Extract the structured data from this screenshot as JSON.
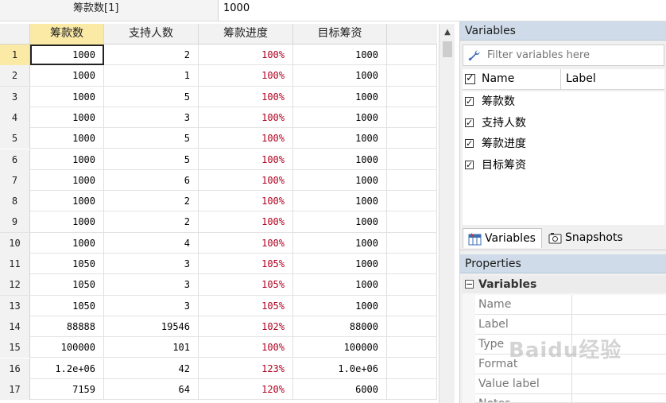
{
  "editbar": {
    "cell_ref": "筹款数[1]",
    "cell_value": "1000"
  },
  "grid": {
    "columns": [
      "筹款数",
      "支持人数",
      "筹款进度",
      "目标筹资"
    ],
    "rows": [
      {
        "n": "1",
        "a": "1000",
        "b": "2",
        "c": "100%",
        "d": "1000"
      },
      {
        "n": "2",
        "a": "1000",
        "b": "1",
        "c": "100%",
        "d": "1000"
      },
      {
        "n": "3",
        "a": "1000",
        "b": "5",
        "c": "100%",
        "d": "1000"
      },
      {
        "n": "4",
        "a": "1000",
        "b": "3",
        "c": "100%",
        "d": "1000"
      },
      {
        "n": "5",
        "a": "1000",
        "b": "5",
        "c": "100%",
        "d": "1000"
      },
      {
        "n": "6",
        "a": "1000",
        "b": "5",
        "c": "100%",
        "d": "1000"
      },
      {
        "n": "7",
        "a": "1000",
        "b": "6",
        "c": "100%",
        "d": "1000"
      },
      {
        "n": "8",
        "a": "1000",
        "b": "2",
        "c": "100%",
        "d": "1000"
      },
      {
        "n": "9",
        "a": "1000",
        "b": "2",
        "c": "100%",
        "d": "1000"
      },
      {
        "n": "10",
        "a": "1000",
        "b": "4",
        "c": "100%",
        "d": "1000"
      },
      {
        "n": "11",
        "a": "1050",
        "b": "3",
        "c": "105%",
        "d": "1000"
      },
      {
        "n": "12",
        "a": "1050",
        "b": "3",
        "c": "105%",
        "d": "1000"
      },
      {
        "n": "13",
        "a": "1050",
        "b": "3",
        "c": "105%",
        "d": "1000"
      },
      {
        "n": "14",
        "a": "88888",
        "b": "19546",
        "c": "102%",
        "d": "88000"
      },
      {
        "n": "15",
        "a": "100000",
        "b": "101",
        "c": "100%",
        "d": "100000"
      },
      {
        "n": "16",
        "a": "1.2e+06",
        "b": "42",
        "c": "123%",
        "d": "1.0e+06"
      },
      {
        "n": "17",
        "a": "7159",
        "b": "64",
        "c": "120%",
        "d": "6000"
      }
    ]
  },
  "variables_panel": {
    "title": "Variables",
    "filter_placeholder": "Filter variables here",
    "col_name": "Name",
    "col_label": "Label",
    "items": [
      "筹款数",
      "支持人数",
      "筹款进度",
      "目标筹资"
    ]
  },
  "tabs": {
    "variables": "Variables",
    "snapshots": "Snapshots"
  },
  "properties_panel": {
    "title": "Properties",
    "section": "Variables",
    "collapse_symbol": "−",
    "rows": [
      "Name",
      "Label",
      "Type",
      "Format",
      "Value label",
      "Notes"
    ]
  },
  "icons": {
    "wrench": "wrench-icon",
    "scroll_up": "▲",
    "variables_tab": "▦",
    "snapshots_tab": "◙"
  },
  "watermark": "Baidu经验"
}
